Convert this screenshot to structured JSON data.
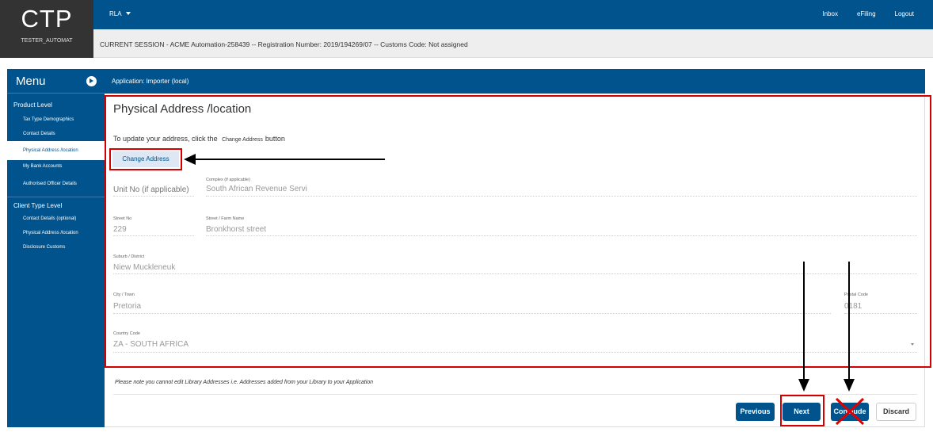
{
  "header": {
    "logo": "CTP",
    "username": "TESTER_AUTOMAT",
    "dropdown_label": "RLA",
    "nav": [
      "Inbox",
      "eFiling",
      "Logout"
    ],
    "session_text": "CURRENT SESSION - ACME Automation-258439 -- Registration Number: 2019/194269/07 -- Customs Code: Not assigned"
  },
  "sidebar": {
    "title": "Menu",
    "product_level": {
      "label": "Product Level",
      "items": [
        "Tax Type Demographics",
        "Contact Details",
        "Physical Address /location",
        "My Bank Accounts",
        "Authorised Officer Details"
      ]
    },
    "client_type_level": {
      "label": "Client Type Level",
      "items": [
        "Contact Details (optional)",
        "Physical Address /location",
        "Disclosure Customs"
      ]
    },
    "active_item": "Physical Address /location"
  },
  "main": {
    "app_title": "Application: Importer (local)",
    "heading": "Physical Address /location",
    "instruction_prefix": "To update your address, click the",
    "instruction_button_ref": "Change Address",
    "instruction_suffix": "button",
    "change_address_button": "Change Address",
    "fields": {
      "unit_no": {
        "placeholder": "Unit No (if applicable)"
      },
      "complex": {
        "label": "Complex (if applicable)",
        "value": "South African Revenue Servi"
      },
      "street_no": {
        "label": "Street No",
        "value": "229"
      },
      "street_name": {
        "label": "Street / Farm Name",
        "value": "Bronkhorst street"
      },
      "suburb": {
        "label": "Suburb / District",
        "value": "Niew Muckleneuk"
      },
      "city": {
        "label": "City / Town",
        "value": "Pretoria"
      },
      "postal_code": {
        "label": "Postal Code",
        "value": "0181"
      },
      "country": {
        "label": "Country Code",
        "value": "ZA - SOUTH AFRICA"
      }
    },
    "note": "Please note  you cannot edit Library Addresses i.e. Addresses added from your Library to your Application",
    "buttons": {
      "previous": "Previous",
      "next": "Next",
      "conclude": "Conclude",
      "discard": "Discard"
    }
  },
  "colors": {
    "primary": "#00538c",
    "header_dark": "#333333",
    "highlight": "#d40000"
  }
}
